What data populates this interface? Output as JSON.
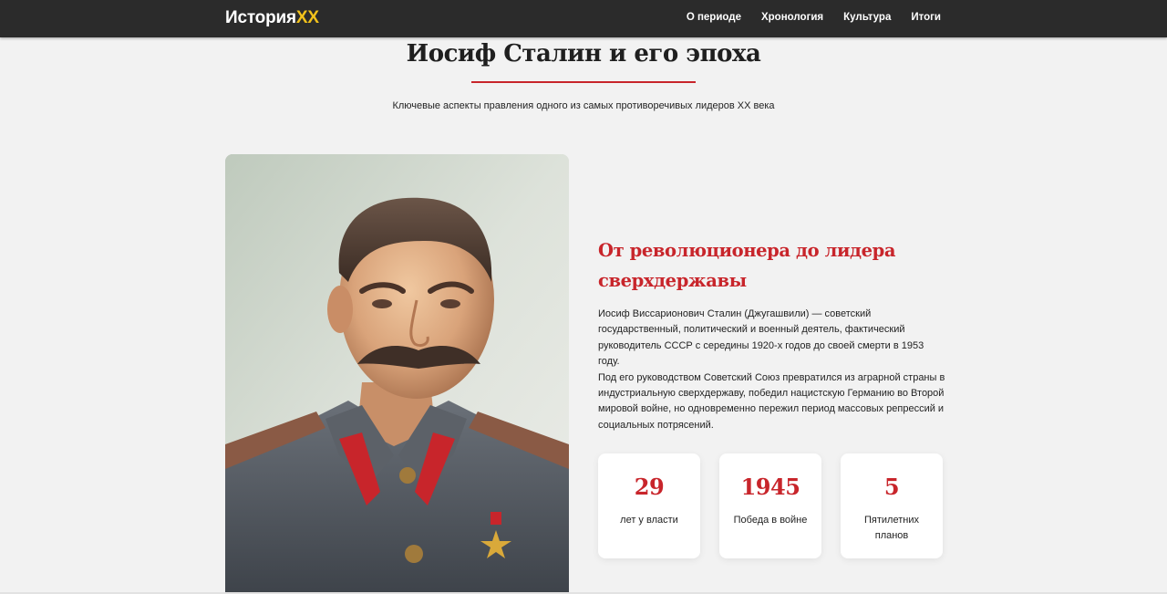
{
  "navbar": {
    "logo_main": "История",
    "logo_accent": "XX",
    "links": [
      "О периоде",
      "Хронология",
      "Культура",
      "Итоги"
    ]
  },
  "hero": {
    "title": "Иосиф Сталин и его эпоха",
    "subtitle": "Ключевые аспекты правления одного из самых противоречивых лидеров XX века"
  },
  "section": {
    "heading": "От революционера до лидера сверхдержавы",
    "paragraph_1": "Иосиф Виссарионович Сталин (Джугашвили) — советский государственный, политический и военный деятель, фактический руководитель СССР с середины 1920-х годов до своей смерти в 1953 году.",
    "paragraph_2": "Под его руководством Советский Союз превратился из аграрной страны в индустриальную сверхдержаву, победил нацистскую Германию во Второй мировой войне, но одновременно пережил период массовых репрессий и социальных потрясений."
  },
  "stats": [
    {
      "value": "29",
      "label": "лет у власти"
    },
    {
      "value": "1945",
      "label": "Победа в войне"
    },
    {
      "value": "5",
      "label": "Пятилетних планов"
    }
  ],
  "colors": {
    "accent_red": "#c8252b",
    "logo_yellow": "#f2c21b",
    "navbar_bg": "#2b2b2b",
    "page_bg": "#f2f2f2"
  }
}
